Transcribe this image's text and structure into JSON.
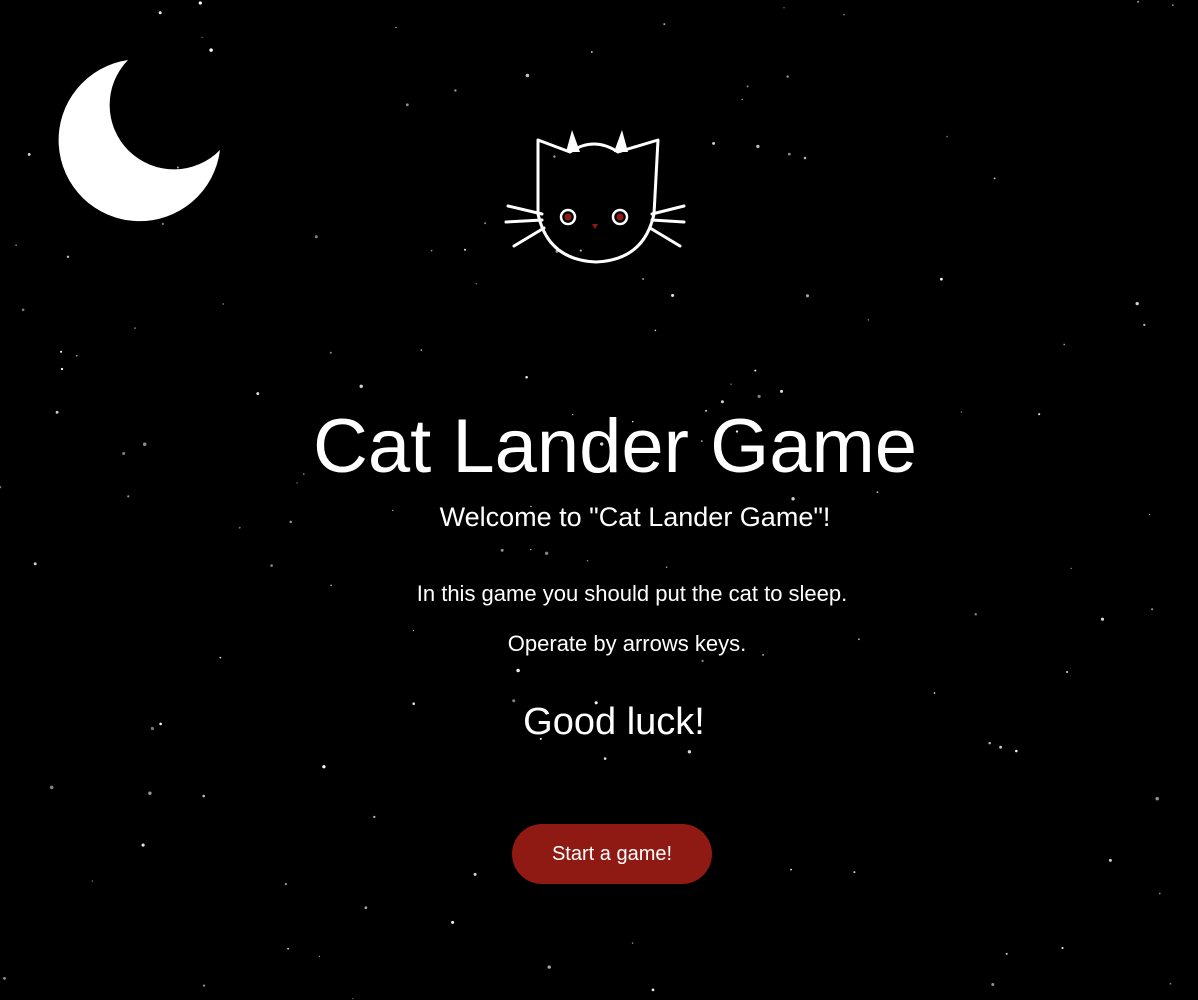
{
  "game": {
    "title": "Cat Lander Game",
    "welcome": "Welcome to \"Cat Lander Game\"!",
    "instruction": "In this game you should put the cat to sleep.",
    "controls": "Operate by arrows keys.",
    "good_luck": "Good luck!",
    "start_button_label": "Start a game!"
  },
  "theme": {
    "background": "#000000",
    "text": "#ffffff",
    "button": "#8f1a14",
    "cat_eye": "#8f1a14",
    "star": "#ffffff"
  },
  "icons": {
    "moon": "crescent-moon-icon",
    "cat": "cat-face-icon"
  }
}
